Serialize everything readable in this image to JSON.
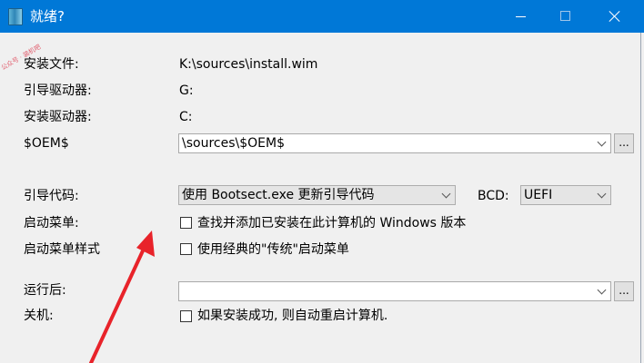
{
  "window": {
    "title": "就绪?",
    "watermark": "公众号 · 装机吧"
  },
  "fields": {
    "install_file": {
      "label": "安装文件:",
      "value": "K:\\sources\\install.wim"
    },
    "boot_drive": {
      "label": "引导驱动器:",
      "value": "G:"
    },
    "install_drive": {
      "label": "安装驱动器:",
      "value": "C:"
    },
    "oem": {
      "label": "$OEM$",
      "value": "\\sources\\$OEM$",
      "browse_label": "..."
    },
    "boot_code": {
      "label": "引导代码:",
      "value": "使用 Bootsect.exe 更新引导代码"
    },
    "bcd": {
      "label": "BCD:",
      "value": "UEFI"
    },
    "boot_menu": {
      "label": "启动菜单:",
      "option": "查找并添加已安装在此计算机的 Windows 版本",
      "checked": false
    },
    "boot_menu_style": {
      "label": "启动菜单样式",
      "option": "使用经典的\"传统\"启动菜单",
      "checked": false
    },
    "run_after": {
      "label": "运行后:",
      "value": "",
      "browse_label": "..."
    },
    "shutdown": {
      "label": "关机:",
      "option": "如果安装成功, 则自动重启计算机.",
      "checked": false
    }
  },
  "colors": {
    "titlebar": "#0078d7",
    "annotation_arrow": "#e8232a"
  }
}
